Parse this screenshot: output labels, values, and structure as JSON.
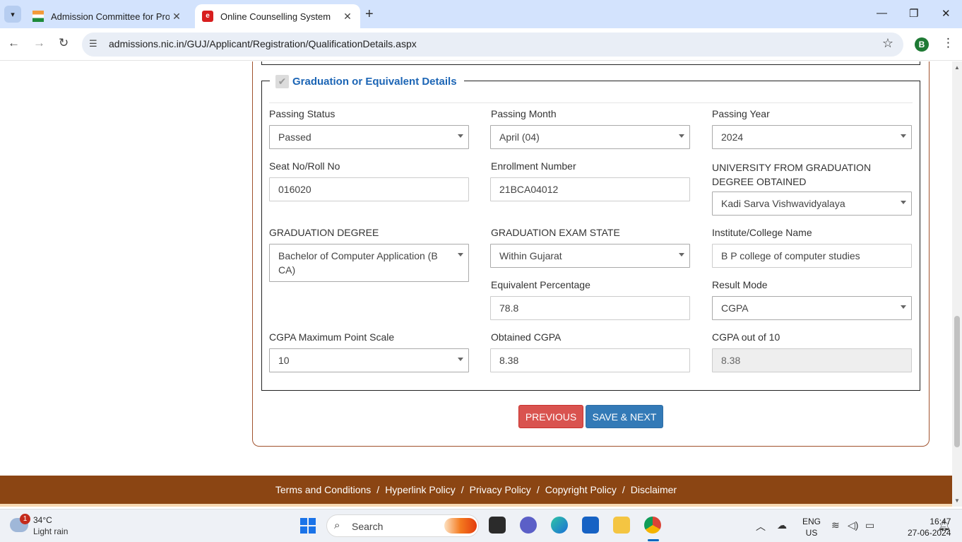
{
  "browser": {
    "tabs": [
      {
        "title": "Admission Committee for Profe",
        "favicon": "india-flag-icon",
        "active": false
      },
      {
        "title": "Online Counselling System",
        "favicon": "nic-logo-icon",
        "active": true
      }
    ],
    "url": "admissions.nic.in/GUJ/Applicant/Registration/QualificationDetails.aspx",
    "profile_initial": "B"
  },
  "form": {
    "section_title": "Graduation or Equivalent Details",
    "section_checked": true,
    "fields": {
      "passing_status": {
        "label": "Passing Status",
        "value": "Passed"
      },
      "passing_month": {
        "label": "Passing Month",
        "value": "April (04)"
      },
      "passing_year": {
        "label": "Passing Year",
        "value": "2024"
      },
      "seat_no": {
        "label": "Seat No/Roll No",
        "value": "016020"
      },
      "enrollment_number": {
        "label": "Enrollment Number",
        "value": "21BCA04012"
      },
      "university": {
        "label": "UNIVERSITY FROM GRADUATION DEGREE OBTAINED",
        "value": "Kadi Sarva Vishwavidyalaya"
      },
      "graduation_degree": {
        "label": "GRADUATION DEGREE",
        "value": "Bachelor of Computer Application (B CA)"
      },
      "exam_state": {
        "label": "GRADUATION EXAM STATE",
        "value": "Within Gujarat"
      },
      "institute": {
        "label": "Institute/College Name",
        "value": "B P college of computer studies"
      },
      "equivalent_percentage": {
        "label": "Equivalent Percentage",
        "value": "78.8"
      },
      "result_mode": {
        "label": "Result Mode",
        "value": "CGPA"
      },
      "cgpa_max_scale": {
        "label": "CGPA Maximum Point Scale",
        "value": "10"
      },
      "obtained_cgpa": {
        "label": "Obtained CGPA",
        "value": "8.38"
      },
      "cgpa_out_of_10": {
        "label": "CGPA out of 10",
        "value": "8.38"
      }
    },
    "buttons": {
      "previous": "PREVIOUS",
      "save_next": "SAVE & NEXT"
    }
  },
  "footer": {
    "links": [
      "Terms and Conditions",
      "Hyperlink Policy",
      "Privacy Policy",
      "Copyright Policy",
      "Disclaimer"
    ],
    "separator": "/"
  },
  "taskbar": {
    "weather": {
      "temp": "34°C",
      "desc": "Light rain",
      "badge": "1"
    },
    "search_placeholder": "Search",
    "lang": "ENG",
    "region": "US",
    "time": "16:47",
    "date": "27-06-2024"
  },
  "colors": {
    "accent_blue": "#337ab7",
    "danger_red": "#d9534f",
    "footer_brown": "#8b4513",
    "legend_blue": "#1c65b5"
  }
}
